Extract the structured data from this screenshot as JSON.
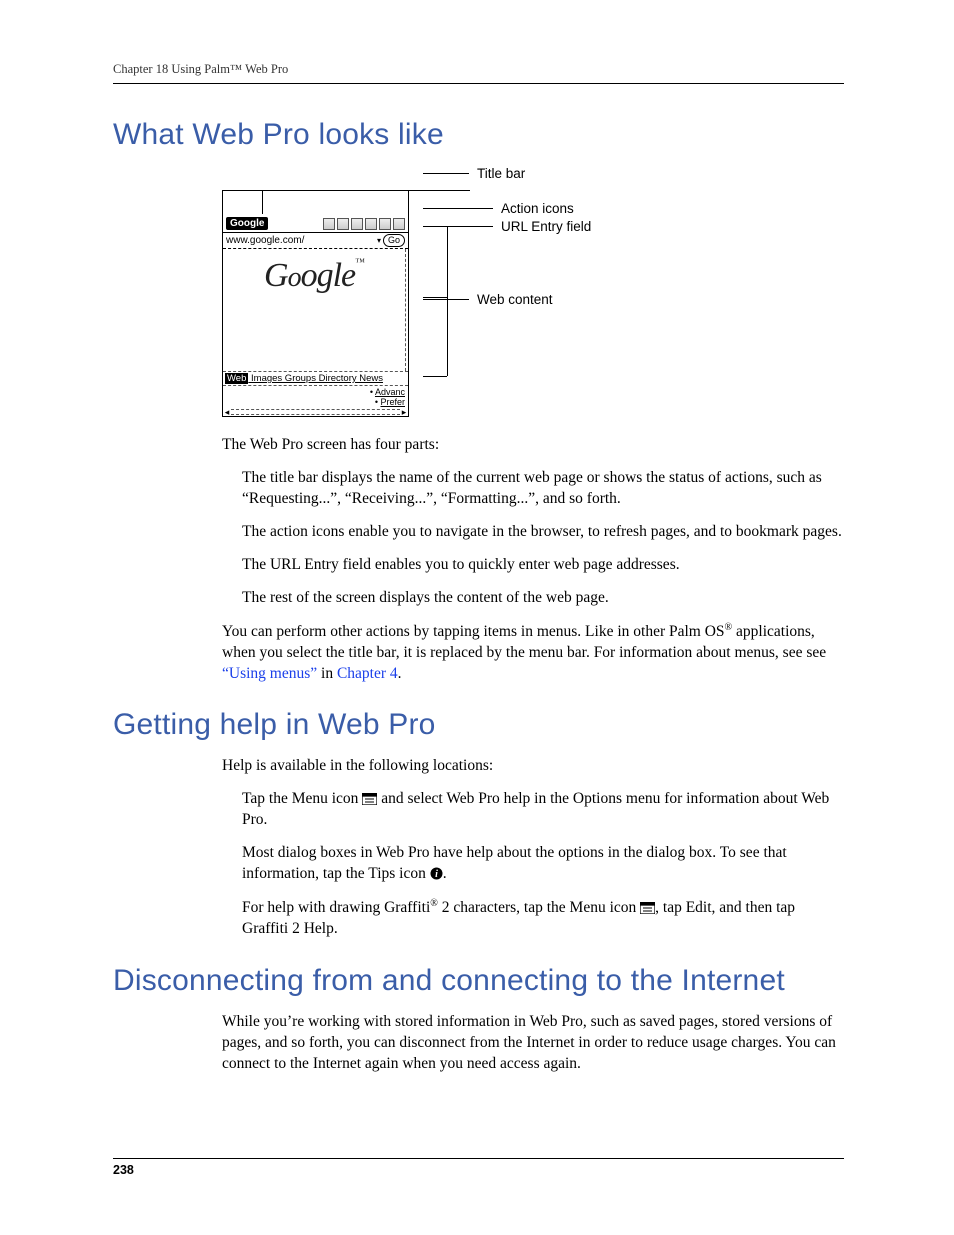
{
  "header": {
    "running": "Chapter 18   Using Palm™ Web Pro"
  },
  "section1": {
    "title": "What Web Pro looks like",
    "callouts": {
      "titlebar": "Title bar",
      "actionicons": "Action icons",
      "urlfield": "URL Entry field",
      "webcontent": "Web content"
    },
    "shot": {
      "title": "Google",
      "url": "www.google.com/",
      "go": "Go",
      "tabs_web": "Web",
      "tabs_rest": "Images Groups Directory News",
      "adv": "Advanc",
      "pref": "Prefer"
    },
    "p_intro": "The Web Pro screen has four parts:",
    "p_title": "The title bar displays the name of the current web page or shows the status of actions, such as “Requesting...”, “Receiving...”, “Formatting...”, and so forth.",
    "p_action": "The action icons enable you to navigate in the browser, to refresh pages, and to bookmark pages.",
    "p_url": "The URL Entry field enables you to quickly enter web page addresses.",
    "p_rest": "The rest of the screen displays the content of the web page.",
    "p_menus_a": "You can perform other actions by tapping items in menus. Like in other Palm OS",
    "p_menus_b": " applications, when you select the title bar, it is replaced by the menu bar. For information about menus, see see ",
    "link1": "“Using menus”",
    "p_menus_c": " in ",
    "link2": "Chapter 4",
    "p_menus_d": "."
  },
  "section2": {
    "title": "Getting help in Web Pro",
    "p_intro": "Help is available in the following locations:",
    "p_tap_a": "Tap the Menu icon ",
    "p_tap_b": " and select Web Pro help in the Options menu for information about Web Pro.",
    "p_dialog_a": "Most dialog boxes in Web Pro have help about the options in the dialog box. To see that information, tap the Tips icon ",
    "p_dialog_b": ".",
    "p_graffiti_a": "For help with drawing Graffiti",
    "p_graffiti_b": " 2 characters, tap the Menu icon ",
    "p_graffiti_c": ", tap Edit, and then tap Graffiti 2 Help."
  },
  "section3": {
    "title": "Disconnecting from and connecting to the Internet",
    "p": "While you’re working with stored information in Web Pro, such as saved pages, stored versions of pages, and so forth, you can disconnect from the Internet in order to reduce usage charges. You can connect to the Internet again when you need access again."
  },
  "footer": {
    "pagenum": "238"
  }
}
